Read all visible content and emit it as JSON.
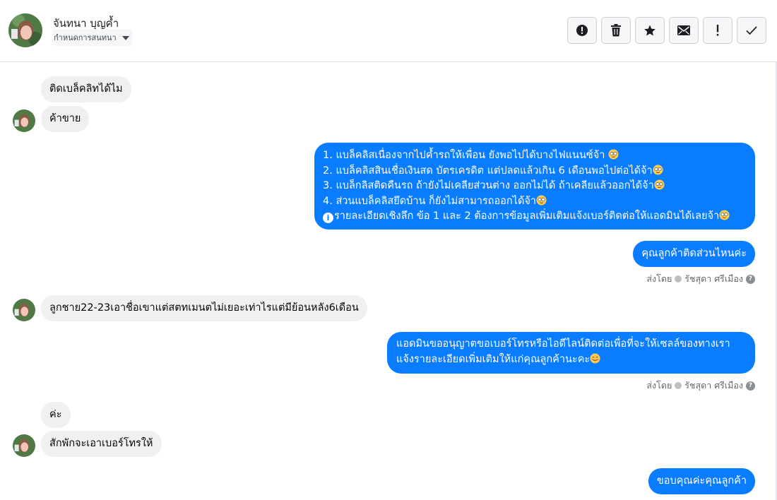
{
  "header": {
    "contact_name": "จันทนา บุญค้ำ",
    "subtitle": "กำหนดการสนทนา"
  },
  "toolbar": {
    "buttons": [
      {
        "name": "spam",
        "icon": "alert-circle-icon"
      },
      {
        "name": "delete",
        "icon": "trash-icon"
      },
      {
        "name": "star",
        "icon": "star-icon"
      },
      {
        "name": "unread",
        "icon": "envelope-icon"
      },
      {
        "name": "important",
        "icon": "exclamation-icon"
      },
      {
        "name": "done",
        "icon": "check-icon"
      }
    ]
  },
  "messages": {
    "m1": "ติดเบล็คลิทได้ไม",
    "m2": "ค้าขาย",
    "m3_lines": [
      "1. แบล็คลิสเนื่องจากไปค้ำรถให้เพื่อน ยังพอไปได้บางไฟแนนซ์จ้า",
      "2. แบล็คลิสสินเชื่อเงินสด บัตรเครดิต แต่ปลดแล้วเกิน 6 เดือนพอไปต่อได้จ้า",
      "3. แบล็กลิสติดคืนรถ ถ้ายังไม่เคลียส่วนต่าง ออกไม่ได้ ถ้าเคลียแล้วออกได้จ้า",
      "4. ส่วนแบล็คลิสยึดบ้าน ก็ยังไม่สามารถออกได้จ้า",
      "รายละเอียดเชิงลึก ข้อ 1 และ 2 ต้องการข้อมูลเพิ่มเติมแจ้งเบอร์ติดต่อให้แอดมินได้เลยจ้า"
    ],
    "m4": "คุณลูกค้าติดส่วนไหนค่ะ",
    "m5": "ลูกชาย22-23เอาชื่อเขาแต่สตทเมนตไม่เยอะเท่าไรแต่มีย้อนหลัง6เดือน",
    "m6_line1": "แอดมินขออนุญาตขอเบอร์โทรหรือไอดีไลน์ติดต่อเพื่อที่จะให้เซลล์ของทางเรา",
    "m6_line2": "แจ้งรายละเอียดเพิ่มเติมให้แก่คุณลูกค้านะคะ",
    "m7": "ค่ะ",
    "m8": "สักพักจะเอาเบอร์โทรให้",
    "m9": "ขอบคุณค่ะคุณลูกค้า"
  },
  "sent_by": {
    "prefix": "ส่งโดย",
    "agent": "รัชสุดา ศรีเมือง"
  },
  "colors": {
    "outgoing_bubble": "#0a7cff",
    "incoming_bubble": "#f0f0f0",
    "border": "#dddfe2"
  }
}
